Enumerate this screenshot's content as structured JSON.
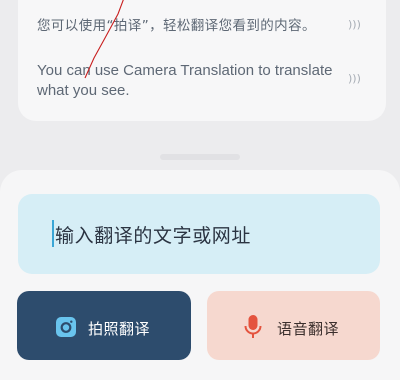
{
  "history": {
    "source_text": "您可以使用“拍译”，轻松翻译您看到的内容。",
    "target_text": "You can use Camera Translation to translate what you see.",
    "source_speaker_icon": "speaker-icon",
    "target_speaker_icon": "speaker-icon"
  },
  "input": {
    "placeholder": "输入翻译的文字或网址"
  },
  "actions": {
    "camera_label": "拍照翻译",
    "camera_icon": "camera-icon",
    "voice_label": "语音翻译",
    "voice_icon": "microphone-icon"
  },
  "colors": {
    "input_bg": "#d6eef6",
    "camera_button": "#2d4c6d",
    "voice_button": "#f6d8cf",
    "accent_mic": "#e4533e",
    "annotation_line": "#c81e1e"
  }
}
